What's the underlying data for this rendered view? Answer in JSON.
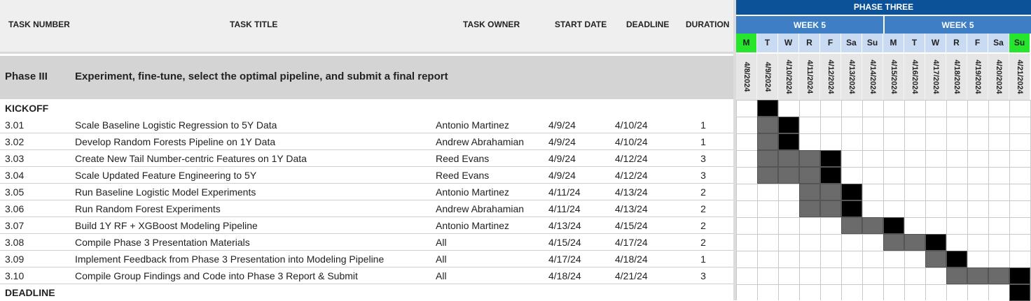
{
  "headers": {
    "task_number": "TASK NUMBER",
    "task_title": "TASK TITLE",
    "task_owner": "TASK OWNER",
    "start_date": "START DATE",
    "deadline": "DEADLINE",
    "duration": "DURATION"
  },
  "phase": {
    "label": "Phase III",
    "description": "Experiment, fine-tune, select the optimal pipeline, and submit a final report"
  },
  "kickoff_label": "KICKOFF",
  "deadline_label": "DEADLINE",
  "tasks": [
    {
      "num": "3.01",
      "title": "Scale Baseline Logistic Regression to 5Y Data",
      "owner": "Antonio Martinez",
      "start": "4/9/24",
      "deadline": "4/10/24",
      "duration": "1"
    },
    {
      "num": "3.02",
      "title": "Develop Random Forests Pipeline on 1Y Data",
      "owner": "Andrew Abrahamian",
      "start": "4/9/24",
      "deadline": "4/10/24",
      "duration": "1"
    },
    {
      "num": "3.03",
      "title": "Create New Tail Number-centric Features on 1Y Data",
      "owner": "Reed Evans",
      "start": "4/9/24",
      "deadline": "4/12/24",
      "duration": "3"
    },
    {
      "num": "3.04",
      "title": "Scale Updated Feature Engineering to 5Y",
      "owner": "Reed Evans",
      "start": "4/9/24",
      "deadline": "4/12/24",
      "duration": "3"
    },
    {
      "num": "3.05",
      "title": "Run Baseline Logistic Model Experiments",
      "owner": "Antonio Martinez",
      "start": "4/11/24",
      "deadline": "4/13/24",
      "duration": "2"
    },
    {
      "num": "3.06",
      "title": "Run Random Forest Experiments",
      "owner": "Andrew Abrahamian",
      "start": "4/11/24",
      "deadline": "4/13/24",
      "duration": "2"
    },
    {
      "num": "3.07",
      "title": "Build 1Y RF + XGBoost Modeling Pipeline",
      "owner": "Antonio Martinez",
      "start": "4/13/24",
      "deadline": "4/15/24",
      "duration": "2"
    },
    {
      "num": "3.08",
      "title": "Compile Phase 3 Presentation Materials",
      "owner": "All",
      "start": "4/15/24",
      "deadline": "4/17/24",
      "duration": "2"
    },
    {
      "num": "3.09",
      "title": "Implement Feedback from Phase 3 Presentation into Modeling Pipeline",
      "owner": "All",
      "start": "4/17/24",
      "deadline": "4/18/24",
      "duration": "1"
    },
    {
      "num": "3.10",
      "title": "Compile Group Findings and Code into Phase 3 Report & Submit",
      "owner": "All",
      "start": "4/18/24",
      "deadline": "4/21/24",
      "duration": "3"
    }
  ],
  "gantt": {
    "phase_title": "PHASE THREE",
    "weeks": [
      "WEEK 5",
      "WEEK 5"
    ],
    "days": [
      {
        "abbr": "M",
        "date": "4/8/2024",
        "highlight": true
      },
      {
        "abbr": "T",
        "date": "4/9/2024",
        "highlight": false
      },
      {
        "abbr": "W",
        "date": "4/10/2024",
        "highlight": false
      },
      {
        "abbr": "R",
        "date": "4/11/2024",
        "highlight": false
      },
      {
        "abbr": "F",
        "date": "4/12/2024",
        "highlight": false
      },
      {
        "abbr": "Sa",
        "date": "4/13/2024",
        "highlight": false
      },
      {
        "abbr": "Su",
        "date": "4/14/2024",
        "highlight": false
      },
      {
        "abbr": "M",
        "date": "4/15/2024",
        "highlight": false
      },
      {
        "abbr": "T",
        "date": "4/16/2024",
        "highlight": false
      },
      {
        "abbr": "W",
        "date": "4/17/2024",
        "highlight": false
      },
      {
        "abbr": "R",
        "date": "4/18/2024",
        "highlight": false
      },
      {
        "abbr": "F",
        "date": "4/19/2024",
        "highlight": false
      },
      {
        "abbr": "Sa",
        "date": "4/20/2024",
        "highlight": false
      },
      {
        "abbr": "Su",
        "date": "4/21/2024",
        "highlight": true
      }
    ],
    "colors": {
      "header_blue": "#0b5299",
      "week_blue": "#3e7ec4",
      "day_blue": "#c9daf3",
      "highlight_green": "#25e52d",
      "bar_gray": "#6b6b6b",
      "bar_black": "#000000"
    },
    "bars": [
      {
        "row": "kickoff",
        "dark": [],
        "black": [
          "4/9/2024"
        ]
      },
      {
        "row": "3.01",
        "dark": [
          "4/9/2024"
        ],
        "black": [
          "4/10/2024"
        ]
      },
      {
        "row": "3.02",
        "dark": [
          "4/9/2024"
        ],
        "black": [
          "4/10/2024"
        ]
      },
      {
        "row": "3.03",
        "dark": [
          "4/9/2024",
          "4/10/2024",
          "4/11/2024"
        ],
        "black": [
          "4/12/2024"
        ]
      },
      {
        "row": "3.04",
        "dark": [
          "4/9/2024",
          "4/10/2024",
          "4/11/2024"
        ],
        "black": [
          "4/12/2024"
        ]
      },
      {
        "row": "3.05",
        "dark": [
          "4/11/2024",
          "4/12/2024"
        ],
        "black": [
          "4/13/2024"
        ]
      },
      {
        "row": "3.06",
        "dark": [
          "4/11/2024",
          "4/12/2024"
        ],
        "black": [
          "4/13/2024"
        ]
      },
      {
        "row": "3.07",
        "dark": [
          "4/13/2024",
          "4/14/2024"
        ],
        "black": [
          "4/15/2024"
        ]
      },
      {
        "row": "3.08",
        "dark": [
          "4/15/2024",
          "4/16/2024"
        ],
        "black": [
          "4/17/2024"
        ]
      },
      {
        "row": "3.09",
        "dark": [
          "4/17/2024"
        ],
        "black": [
          "4/18/2024"
        ]
      },
      {
        "row": "3.10",
        "dark": [
          "4/18/2024",
          "4/19/2024",
          "4/20/2024"
        ],
        "black": [
          "4/21/2024"
        ]
      },
      {
        "row": "deadline",
        "dark": [],
        "black": [
          "4/21/2024"
        ]
      }
    ]
  }
}
